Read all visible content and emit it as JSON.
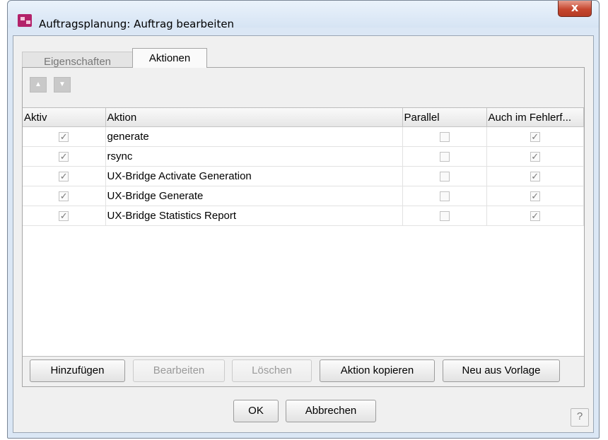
{
  "window": {
    "title": "Auftragsplanung: Auftrag bearbeiten",
    "close_label": "x"
  },
  "tabs": [
    {
      "label": "Eigenschaften",
      "active": false
    },
    {
      "label": "Aktionen",
      "active": true
    }
  ],
  "move_buttons": {
    "up": "▲",
    "down": "▼"
  },
  "table": {
    "columns": [
      "Aktiv",
      "Aktion",
      "Parallel",
      "Auch im Fehlerf..."
    ],
    "rows": [
      {
        "aktiv": true,
        "aktion": "generate",
        "parallel": false,
        "fehlerfall": true
      },
      {
        "aktiv": true,
        "aktion": "rsync",
        "parallel": false,
        "fehlerfall": true
      },
      {
        "aktiv": true,
        "aktion": "UX-Bridge Activate Generation",
        "parallel": false,
        "fehlerfall": true
      },
      {
        "aktiv": true,
        "aktion": "UX-Bridge Generate",
        "parallel": false,
        "fehlerfall": true
      },
      {
        "aktiv": true,
        "aktion": "UX-Bridge Statistics Report",
        "parallel": false,
        "fehlerfall": true
      }
    ],
    "check_glyph": "✓"
  },
  "action_buttons": [
    {
      "label": "Hinzufügen",
      "enabled": true
    },
    {
      "label": "Bearbeiten",
      "enabled": false
    },
    {
      "label": "Löschen",
      "enabled": false
    },
    {
      "label": "Aktion kopieren",
      "enabled": true
    },
    {
      "label": "Neu aus Vorlage",
      "enabled": true
    }
  ],
  "dialog_buttons": {
    "ok": "OK",
    "cancel": "Abbrechen",
    "help": "?"
  }
}
